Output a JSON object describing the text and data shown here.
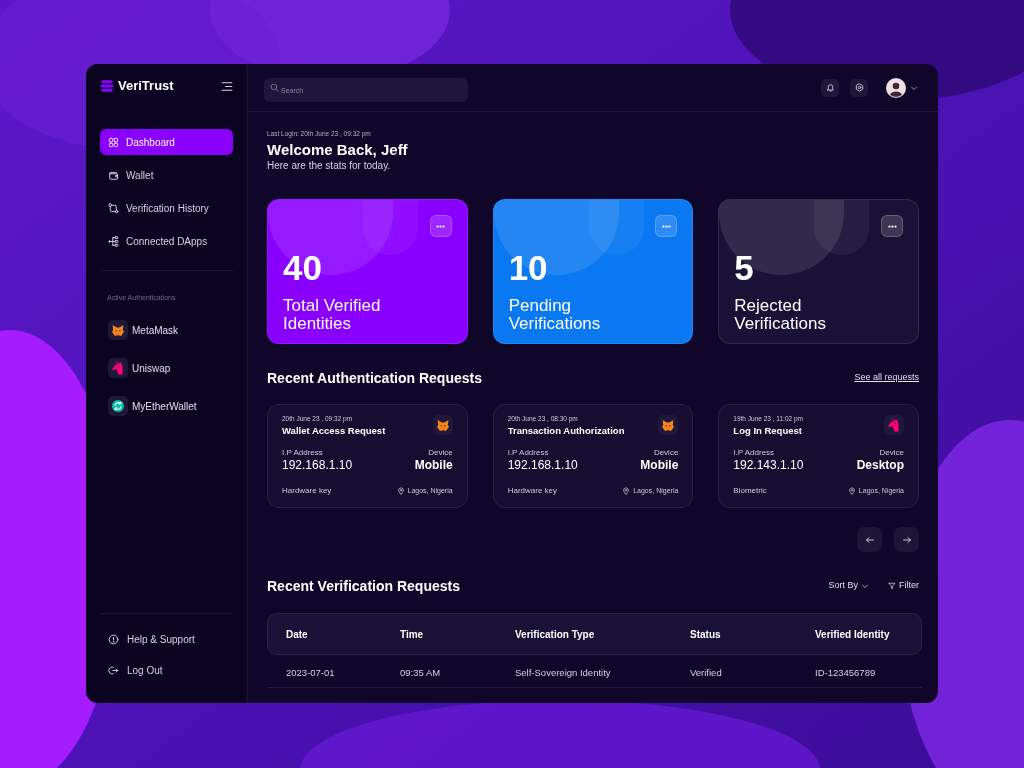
{
  "sidebar": {
    "logo": "VeriTrust",
    "nav": [
      {
        "label": "Dashboard",
        "selected": true
      },
      {
        "label": "Wallet",
        "selected": false
      },
      {
        "label": "Verification History",
        "selected": false
      },
      {
        "label": "Connected DApps",
        "selected": false
      }
    ],
    "section_label": "Active Authentications",
    "authentications": [
      {
        "name": "MetaMask",
        "kind": "metamask"
      },
      {
        "name": "Uniswap",
        "kind": "uniswap"
      },
      {
        "name": "MyEtherWallet",
        "kind": "myetherwallet"
      }
    ],
    "footer": [
      {
        "label": "Help & Support"
      },
      {
        "label": "Log Out"
      }
    ]
  },
  "topbar": {
    "search": {
      "placeholder": "Search"
    }
  },
  "welcome": {
    "last_login": "Last Login: 20th June 23 , 09:32 pm",
    "title": "Welcome Back, Jeff",
    "subtitle": "Here are the stats for today."
  },
  "stats": [
    {
      "value": "40",
      "label": "Total Verified Identities",
      "color": "#8a00ff"
    },
    {
      "value": "10",
      "label": "Pending Verifications",
      "color": "#0a78f0"
    },
    {
      "value": "5",
      "label": "Rejected Verifications",
      "color": "#1a1236"
    }
  ],
  "auth_requests": {
    "title": "Recent Authentication Requests",
    "link": "See all requests",
    "cards": [
      {
        "date": "20th June 23 , 09:32 pm",
        "title": "Wallet Access Request",
        "kind": "metamask",
        "ip_label": "I.P Address",
        "ip": "192.168.1.10",
        "device_label": "Device",
        "device": "Mobile",
        "method": "Hardware key",
        "location": "Lagos, Nigeria"
      },
      {
        "date": "20th June 23 , 08:30 pm",
        "title": "Transaction Authorization",
        "kind": "metamask",
        "ip_label": "I.P Address",
        "ip": "192.168.1.10",
        "device_label": "Device",
        "device": "Mobile",
        "method": "Hardware key",
        "location": "Lagos, Nigeria"
      },
      {
        "date": "19th June 23 , 11:02 pm",
        "title": "Log In Request",
        "kind": "uniswap",
        "ip_label": "I.P Address",
        "ip": "192.143.1.10",
        "device_label": "Device",
        "device": "Desktop",
        "method": "Biometric",
        "location": "Lagos, Nigeria"
      }
    ]
  },
  "verification_requests": {
    "title": "Recent Verification Requests",
    "sort": "Sort By",
    "filter": "Filter",
    "table": {
      "columns": [
        "Date",
        "Time",
        "Verification Type",
        "Status",
        "Verified Identity"
      ],
      "rows": [
        [
          "2023-07-01",
          "09:35 AM",
          "Self-Sovereign Identity",
          "Verified",
          "ID-123456789"
        ]
      ]
    }
  }
}
